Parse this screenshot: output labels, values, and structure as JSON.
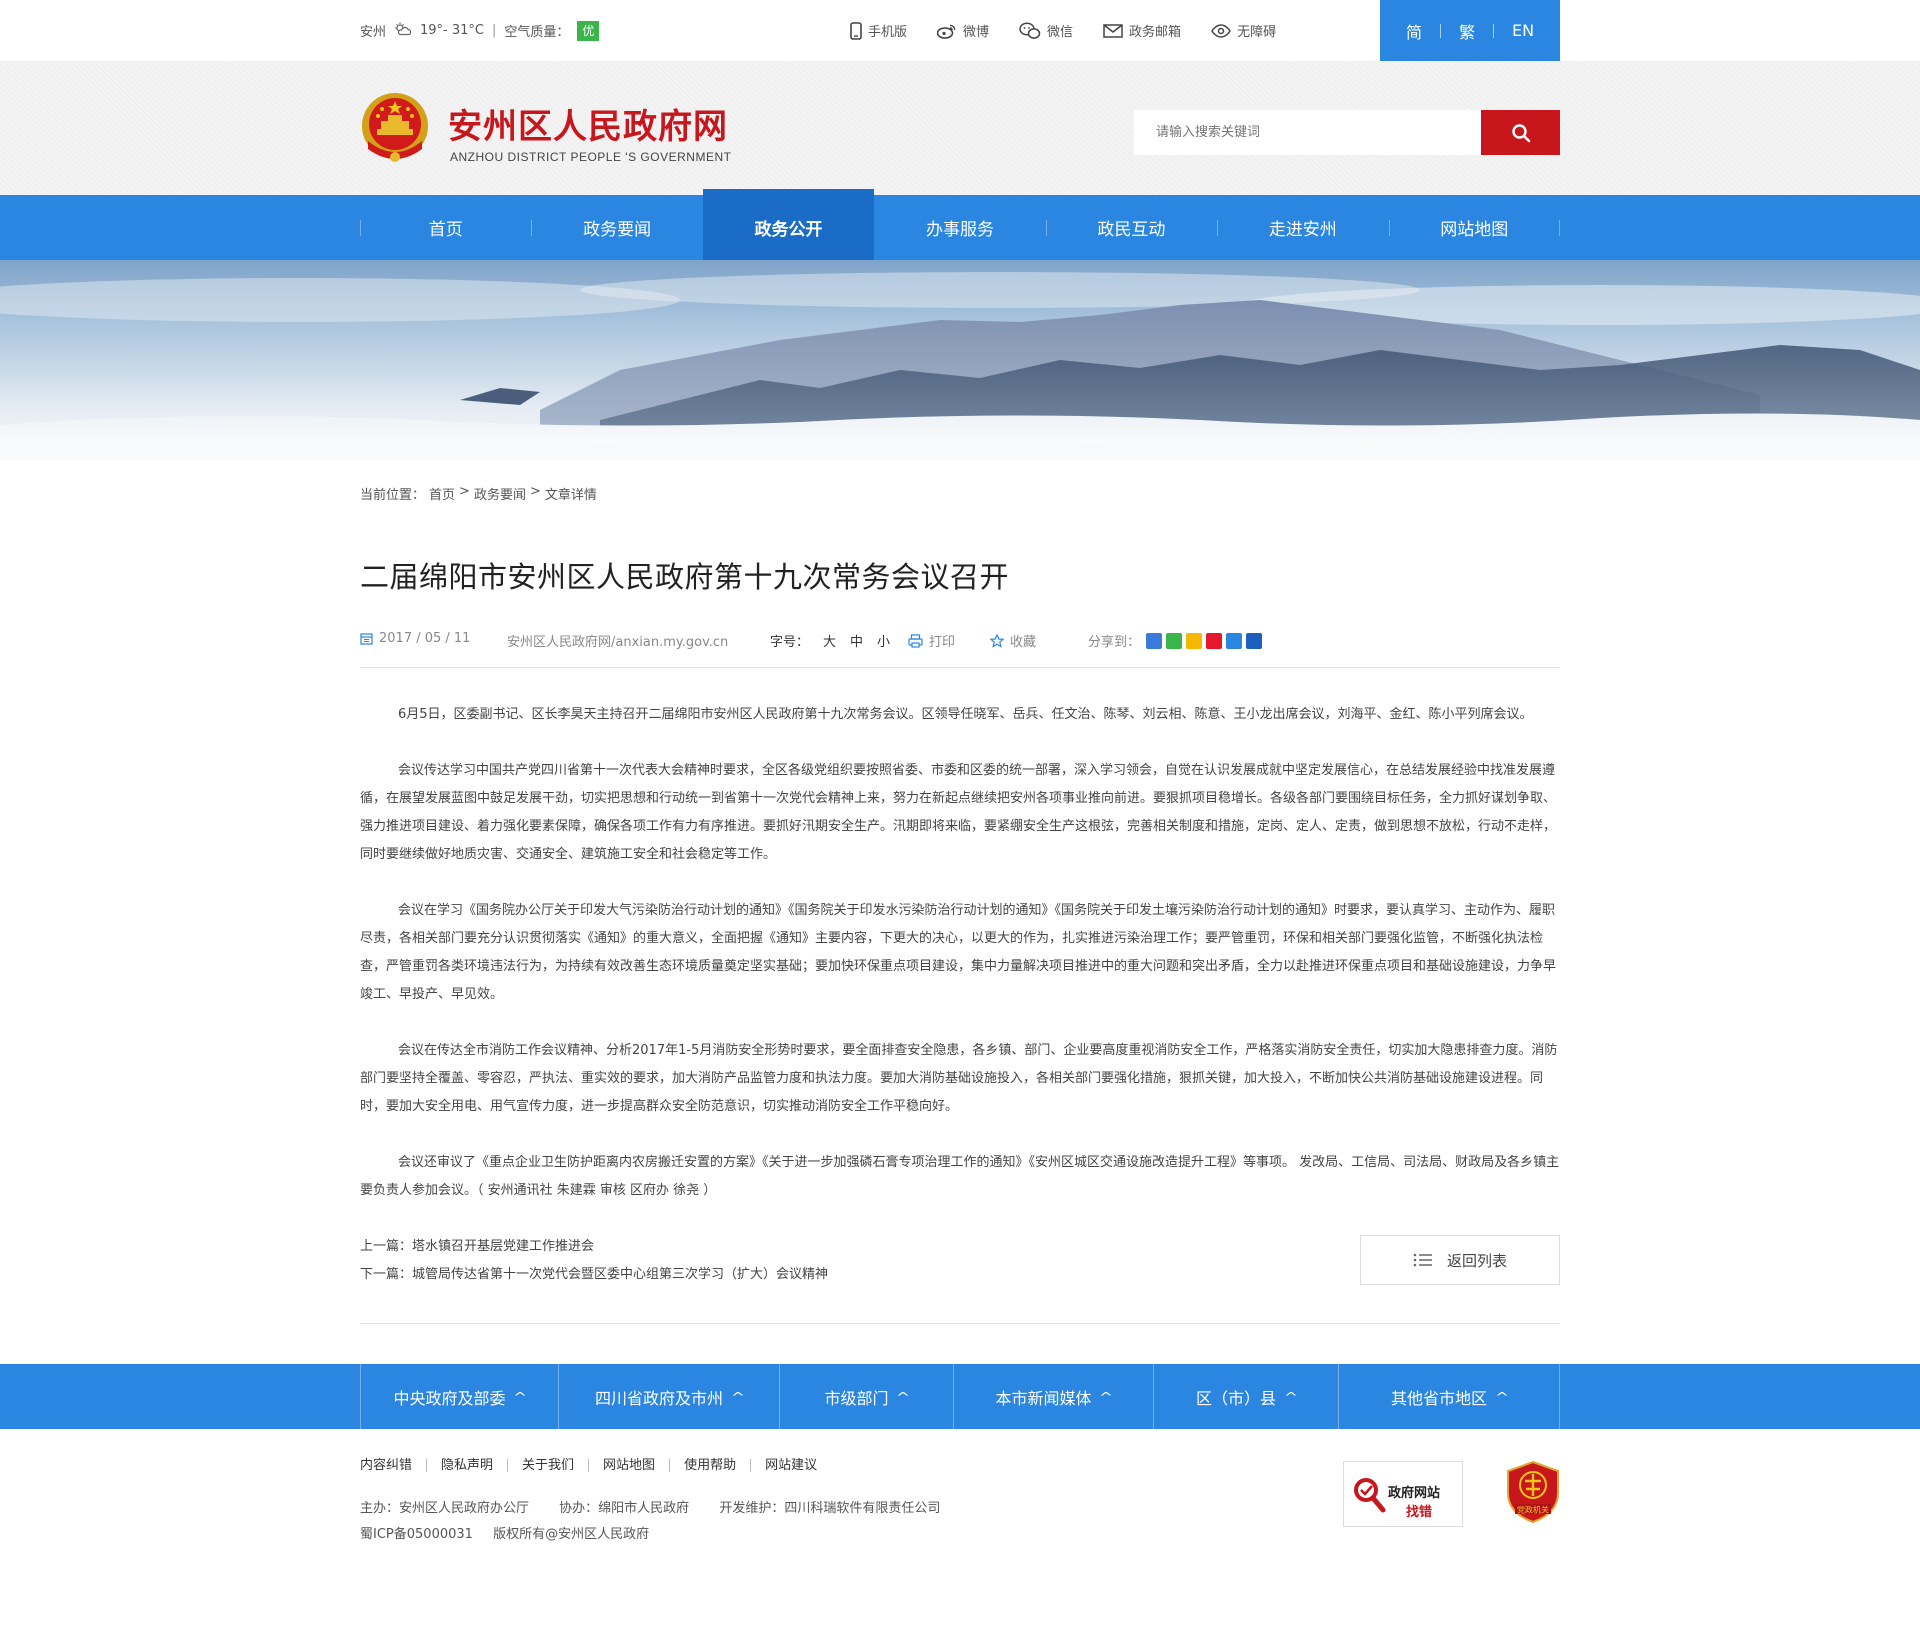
{
  "topbar": {
    "city": "安州",
    "temperature": "19°- 31°C",
    "separator": "|",
    "air_quality_label": "空气质量：",
    "air_quality_value": "优",
    "links": [
      {
        "icon": "mobile-icon",
        "label": "手机版"
      },
      {
        "icon": "weibo-icon",
        "label": "微博"
      },
      {
        "icon": "wechat-icon",
        "label": "微信"
      },
      {
        "icon": "mail-icon",
        "label": "政务邮箱"
      },
      {
        "icon": "eye-icon",
        "label": "无障碍"
      }
    ],
    "languages": [
      "简",
      "繁",
      "EN"
    ]
  },
  "header": {
    "title": "安州区人民政府网",
    "subtitle": "ANZHOU DISTRICT PEOPLE 'S GOVERNMENT",
    "search_placeholder": "请输入搜索关键词"
  },
  "nav": {
    "items": [
      "首页",
      "政务要闻",
      "政务公开",
      "办事服务",
      "政民互动",
      "走进安州",
      "网站地图"
    ],
    "active_index": 2
  },
  "breadcrumb": {
    "prefix": "当前位置：",
    "items": [
      "首页",
      "政务要闻",
      "文章详情"
    ],
    "separator": ">"
  },
  "article": {
    "title": "二届绵阳市安州区人民政府第十九次常务会议召开",
    "date": "2017 / 05 / 11",
    "source": "安州区人民政府网/anxian.my.gov.cn",
    "font_size_label": "字号：",
    "font_sizes": [
      "大",
      "中",
      "小"
    ],
    "print_label": "打印",
    "favorite_label": "收藏",
    "share_label": "分享到：",
    "paragraphs": [
      "6月5日，区委副书记、区长李昊天主持召开二届绵阳市安州区人民政府第十九次常务会议。区领导任晓军、岳兵、任文治、陈琴、刘云相、陈意、王小龙出席会议，刘海平、金红、陈小平列席会议。",
      "会议传达学习中国共产党四川省第十一次代表大会精神时要求，全区各级党组织要按照省委、市委和区委的统一部署，深入学习领会，自觉在认识发展成就中坚定发展信心，在总结发展经验中找准发展遵循，在展望发展蓝图中鼓足发展干劲，切实把思想和行动统一到省第十一次党代会精神上来，努力在新起点继续把安州各项事业推向前进。要狠抓项目稳增长。各级各部门要围绕目标任务，全力抓好谋划争取、强力推进项目建设、着力强化要素保障，确保各项工作有力有序推进。要抓好汛期安全生产。汛期即将来临，要紧绷安全生产这根弦，完善相关制度和措施，定岗、定人、定责，做到思想不放松，行动不走样，同时要继续做好地质灾害、交通安全、建筑施工安全和社会稳定等工作。",
      "会议在学习《国务院办公厅关于印发大气污染防治行动计划的通知》《国务院关于印发水污染防治行动计划的通知》《国务院关于印发土壤污染防治行动计划的通知》时要求，要认真学习、主动作为、履职尽责，各相关部门要充分认识贯彻落实《通知》的重大意义，全面把握《通知》主要内容，下更大的决心，以更大的作为，扎实推进污染治理工作；要严管重罚，环保和相关部门要强化监管，不断强化执法检查，严管重罚各类环境违法行为，为持续有效改善生态环境质量奠定坚实基础；要加快环保重点项目建设，集中力量解决项目推进中的重大问题和突出矛盾，全力以赴推进环保重点项目和基础设施建设，力争早竣工、早投产、早见效。",
      "会议在传达全市消防工作会议精神、分析2017年1-5月消防安全形势时要求，要全面排查安全隐患，各乡镇、部门、企业要高度重视消防安全工作，严格落实消防安全责任，切实加大隐患排查力度。消防部门要坚持全覆盖、零容忍，严执法、重实效的要求，加大消防产品监管力度和执法力度。要加大消防基础设施投入，各相关部门要强化措施，狠抓关键，加大投入，不断加快公共消防基础设施建设进程。同时，要加大安全用电、用气宣传力度，进一步提高群众安全防范意识，切实推动消防安全工作平稳向好。",
      "会议还审议了《重点企业卫生防护距离内农房搬迁安置的方案》《关于进一步加强磷石膏专项治理工作的通知》《安州区城区交通设施改造提升工程》等事项。 发改局、工信局、司法局、财政局及各乡镇主要负责人参加会议。（ 安州通讯社 朱建霖 审核 区府办 徐尧 ）"
    ],
    "prev_label": "上一篇：",
    "prev_title": "塔水镇召开基层党建工作推进会",
    "next_label": "下一篇：",
    "next_title": "城管局传达省第十一次党代会暨区委中心组第三次学习（扩大）会议精神",
    "back_label": "返回列表"
  },
  "footer_links": {
    "items": [
      "中央政府及部委",
      "四川省政府及市州",
      "市级部门",
      "本市新闻媒体",
      "区（市）县",
      "其他省市地区"
    ],
    "caret": "^"
  },
  "footer": {
    "links": [
      "内容纠错",
      "隐私声明",
      "关于我们",
      "网站地图",
      "使用帮助",
      "网站建议"
    ],
    "sponsor": "主办：安州区人民政府办公厅",
    "co_sponsor": "协办：绵阳市人民政府",
    "developer": "开发维护：四川科瑞软件有限责任公司",
    "icp": "蜀ICP备05000031",
    "copyright": "版权所有@安州区人民政府",
    "badge_error_line1": "政府网站",
    "badge_error_line2": "找错",
    "badge_party_label": "党政机关"
  },
  "colors": {
    "brand_blue": "#2a86e0",
    "active_blue": "#1a6cc6",
    "brand_red": "#c8161d",
    "aqi_green": "#3bb54a"
  }
}
